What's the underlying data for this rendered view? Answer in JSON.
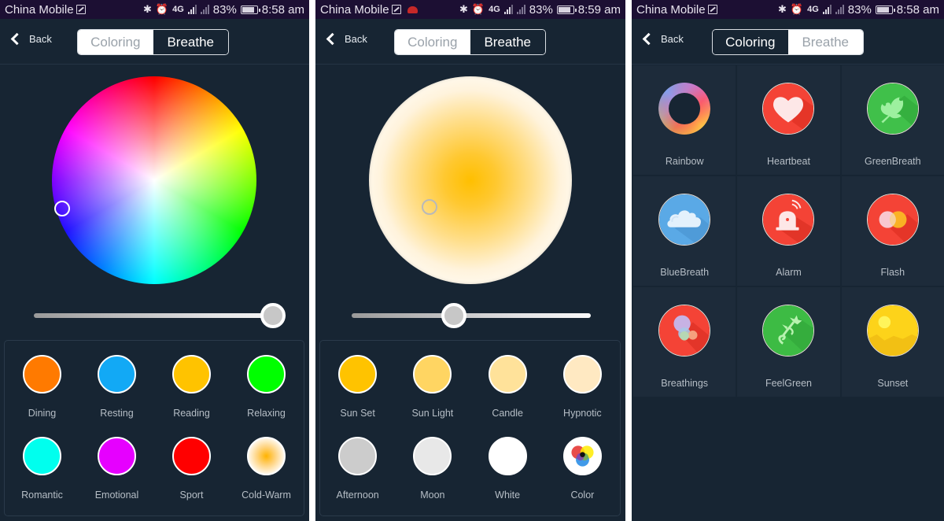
{
  "status_bars": [
    {
      "carrier": "China Mobile",
      "battery": "83%",
      "time": "8:58 am",
      "network": "4G",
      "network_small": "4G",
      "missed_call": false
    },
    {
      "carrier": "China Mobile",
      "battery": "83%",
      "time": "8:59 am",
      "network": "4G",
      "network_small": "4G",
      "missed_call": true
    },
    {
      "carrier": "China Mobile",
      "battery": "83%",
      "time": "8:58 am",
      "network": "4G",
      "network_small": "4G",
      "missed_call": false
    }
  ],
  "header": {
    "back_label": "Back",
    "tabs": [
      "Coloring",
      "Breathe"
    ]
  },
  "screens": [
    {
      "selected_tab": "Breathe",
      "picker": "color-wheel",
      "brightness_percent": 100,
      "presets": [
        {
          "label": "Dining",
          "color": "#ff7a00"
        },
        {
          "label": "Resting",
          "color": "#12a9f5"
        },
        {
          "label": "Reading",
          "color": "#ffc300"
        },
        {
          "label": "Relaxing",
          "color": "#00ff00"
        },
        {
          "label": "Romantic",
          "color": "#00ffee"
        },
        {
          "label": "Emotional",
          "color": "#e600ff"
        },
        {
          "label": "Sport",
          "color": "#ff0000"
        },
        {
          "label": "Cold-Warm",
          "color": "radial-warm"
        }
      ]
    },
    {
      "selected_tab": "Breathe",
      "picker": "warm-white-wheel",
      "brightness_percent": 45,
      "presets": [
        {
          "label": "Sun Set",
          "color": "#ffc300"
        },
        {
          "label": "Sun Light",
          "color": "#ffd562"
        },
        {
          "label": "Candle",
          "color": "#ffe29a"
        },
        {
          "label": "Hypnotic",
          "color": "#ffe9c2"
        },
        {
          "label": "Afternoon",
          "color": "#cccccc"
        },
        {
          "label": "Moon",
          "color": "#e8e8e8"
        },
        {
          "label": "White",
          "color": "#ffffff"
        },
        {
          "label": "Color",
          "color": "rgb-mix"
        }
      ]
    },
    {
      "selected_tab": "Coloring",
      "modes": [
        {
          "label": "Rainbow",
          "icon": "rainbow-ring-icon"
        },
        {
          "label": "Heartbeat",
          "icon": "heart-icon"
        },
        {
          "label": "GreenBreath",
          "icon": "leaf-icon"
        },
        {
          "label": "BlueBreath",
          "icon": "cloud-icon"
        },
        {
          "label": "Alarm",
          "icon": "alarm-siren-icon"
        },
        {
          "label": "Flash",
          "icon": "flash-circles-icon"
        },
        {
          "label": "Breathings",
          "icon": "bubbles-icon"
        },
        {
          "label": "FeelGreen",
          "icon": "sprout-icon"
        },
        {
          "label": "Sunset",
          "icon": "sunset-icon"
        }
      ]
    }
  ]
}
